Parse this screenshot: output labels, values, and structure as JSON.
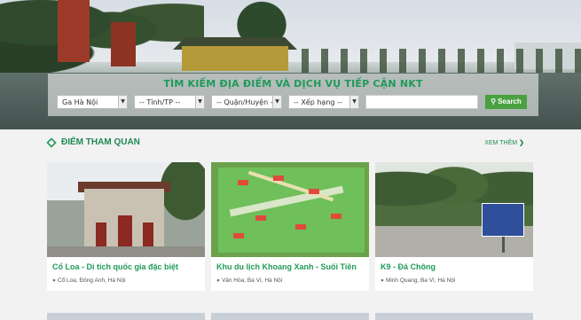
{
  "search": {
    "title": "TÌM KIẾM ĐỊA ĐIỂM VÀ DỊCH VỤ TIẾP CẬN NKT",
    "city_selected": "Ga Hà Nội",
    "province_selected": "-- Tỉnh/TP --",
    "district_selected": "-- Quận/Huyện --",
    "rank_selected": "-- Xếp hạng --",
    "query_value": "",
    "button_label": "Search"
  },
  "section": {
    "title": "ĐIỂM THAM QUAN",
    "see_more": "XEM THÊM"
  },
  "cards": [
    {
      "name": "Cổ Loa - Di tích quốc gia đặc biệt",
      "address": "Cổ Loa, Đông Anh, Hà Nội"
    },
    {
      "name": "Khu du lịch Khoang Xanh - Suối Tiên",
      "address": "Vân Hòa, Ba Vì, Hà Nội"
    },
    {
      "name": "K9 - Đá Chông",
      "address": "Minh Quang, Ba Vì, Hà Nội"
    }
  ],
  "colors": {
    "brand_green": "#1f9a5a",
    "search_button": "#4aa13f"
  },
  "icons": {
    "section": "diamond-icon",
    "search": "search-icon",
    "address": "map-pin-icon",
    "see_more": "chevron-right-icon"
  }
}
